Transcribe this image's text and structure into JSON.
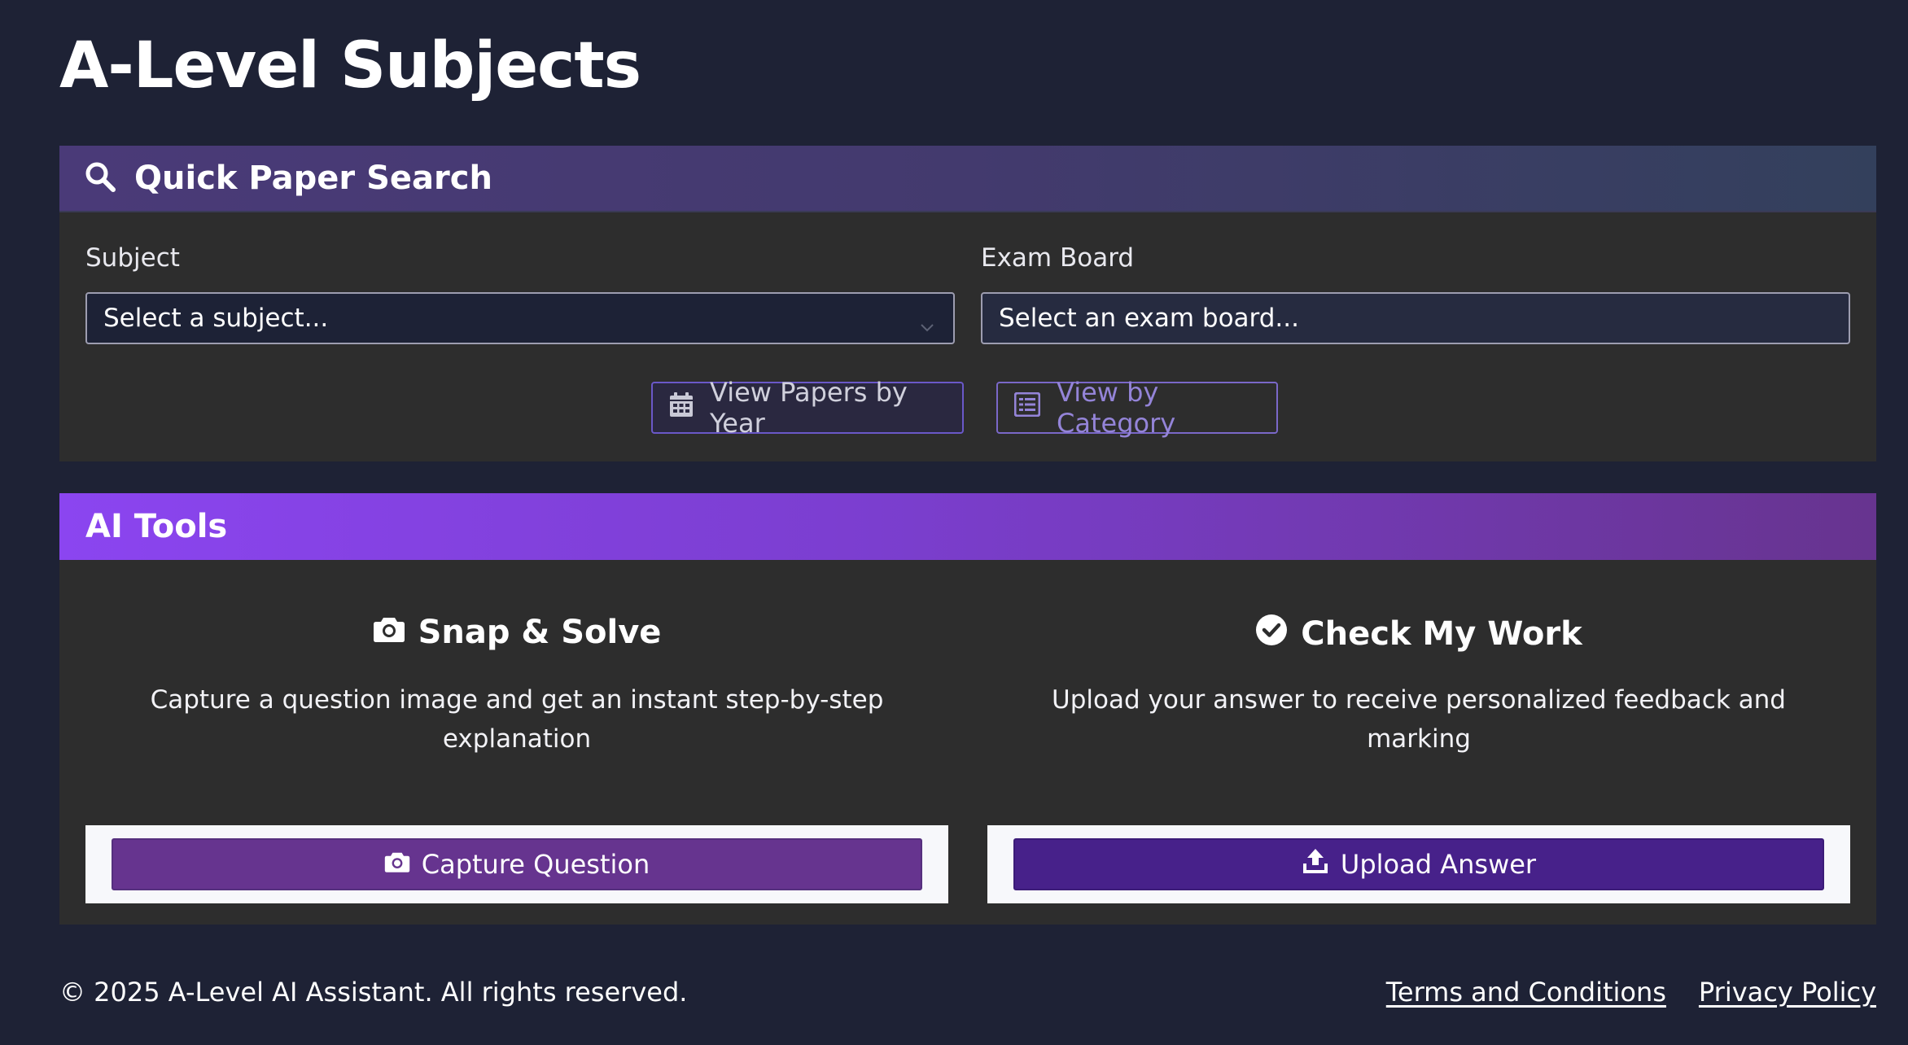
{
  "page": {
    "title": "A-Level Subjects"
  },
  "search": {
    "header": "Quick Paper Search",
    "icon": "search-icon",
    "subject_label": "Subject",
    "subject_value": "Select a subject...",
    "board_label": "Exam Board",
    "board_value": "Select an exam board...",
    "year_button": "View Papers by Year",
    "category_button": "View by Category"
  },
  "tools": {
    "header": "AI Tools",
    "items": [
      {
        "title": "Snap & Solve",
        "icon": "camera-icon",
        "description": "Capture a question image and get an instant step-by-step explanation",
        "button": "Capture Question",
        "button_icon": "camera-icon"
      },
      {
        "title": "Check My Work",
        "icon": "check-circle-icon",
        "description": "Upload your answer to receive personalized feedback and marking",
        "button": "Upload Answer",
        "button_icon": "upload-icon"
      }
    ]
  },
  "footer": {
    "copyright": "© 2025 A-Level AI Assistant. All rights reserved.",
    "terms": "Terms and Conditions",
    "privacy": "Privacy Policy"
  },
  "colors": {
    "background": "#1e2235",
    "card": "#2d2d2d",
    "accent_purple": "#8b45f0",
    "capture_button": "#66348f",
    "upload_button": "#47218a"
  }
}
